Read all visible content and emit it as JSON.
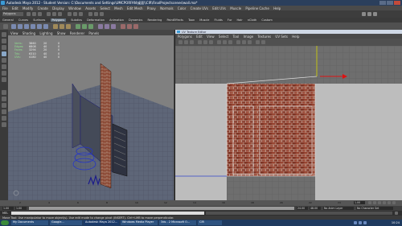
{
  "titlebar": {
    "title": "Autodesk Maya 2012 - Student Version: C:\\Documents and Settings\\UMCPORFAN\\桌面\\\\CIR\\FinalProjectscenes\\wall.ma*"
  },
  "menubar": {
    "items": [
      "File",
      "Edit",
      "Modify",
      "Create",
      "Display",
      "Window",
      "Assets",
      "Select",
      "Mesh",
      "Edit Mesh",
      "Proxy",
      "Normals",
      "Color",
      "Create UVs",
      "Edit UVs",
      "Muscle",
      "Pipeline Cache",
      "Help"
    ]
  },
  "statusline": {
    "mode": "Polygons"
  },
  "shelf": {
    "tabs": [
      "General",
      "Curves",
      "Surfaces",
      "Polygons",
      "Subdivs",
      "Deformation",
      "Animation",
      "Dynamics",
      "Rendering",
      "PaintEffects",
      "Toon",
      "Muscle",
      "Fluids",
      "Fur",
      "Hair",
      "nCloth",
      "Custom"
    ],
    "active_tab": "Polygons"
  },
  "panel": {
    "menu": [
      "View",
      "Shading",
      "Lighting",
      "Show",
      "Renderer",
      "Panels"
    ]
  },
  "hud": {
    "rows": [
      {
        "label": "Verts:",
        "a": "3860",
        "b": "20",
        "c": "0"
      },
      {
        "label": "Edges:",
        "a": "6808",
        "b": "40",
        "c": "0"
      },
      {
        "label": "Faces:",
        "a": "3294",
        "b": "20",
        "c": "0"
      },
      {
        "label": "Tris:",
        "a": "6310",
        "b": "40",
        "c": "0"
      },
      {
        "label": "UVs:",
        "a": "4180",
        "b": "40",
        "c": "0"
      }
    ]
  },
  "uv_editor": {
    "title": "UV Texture Editor",
    "menu": [
      "Polygons",
      "Edit",
      "View",
      "Select",
      "Tool",
      "Image",
      "Textures",
      "UV Sets",
      "Help"
    ]
  },
  "timeslider": {
    "ticks": [
      "2",
      "4",
      "6",
      "8",
      "10",
      "12",
      "14",
      "16",
      "18",
      "20",
      "22",
      "24"
    ],
    "current": "1.00"
  },
  "range": {
    "start": "1.00",
    "start2": "1.00",
    "end": "24.00",
    "end2": "48.00",
    "anim_layer": "No Anim Layer",
    "char_set": "No Character Set"
  },
  "cmdline": {
    "label": "MEL"
  },
  "help": {
    "text": "Move Tool: Use manipulator to move object(s). Use edit mode to change pivot (INSERT). Ctrl+LMB to move perpendicular."
  },
  "taskbar": {
    "buttons": [
      "My Documents",
      "Google...",
      "Autodesk Maya 2012...",
      "Windows Media Player",
      "3ds - 2 Microsoft O...",
      "CIR"
    ],
    "clock": "10:24"
  },
  "colors": {
    "accent": "#2b3f5c",
    "uv_title": "#cfd8e6",
    "brick": "#8c3a2a"
  }
}
